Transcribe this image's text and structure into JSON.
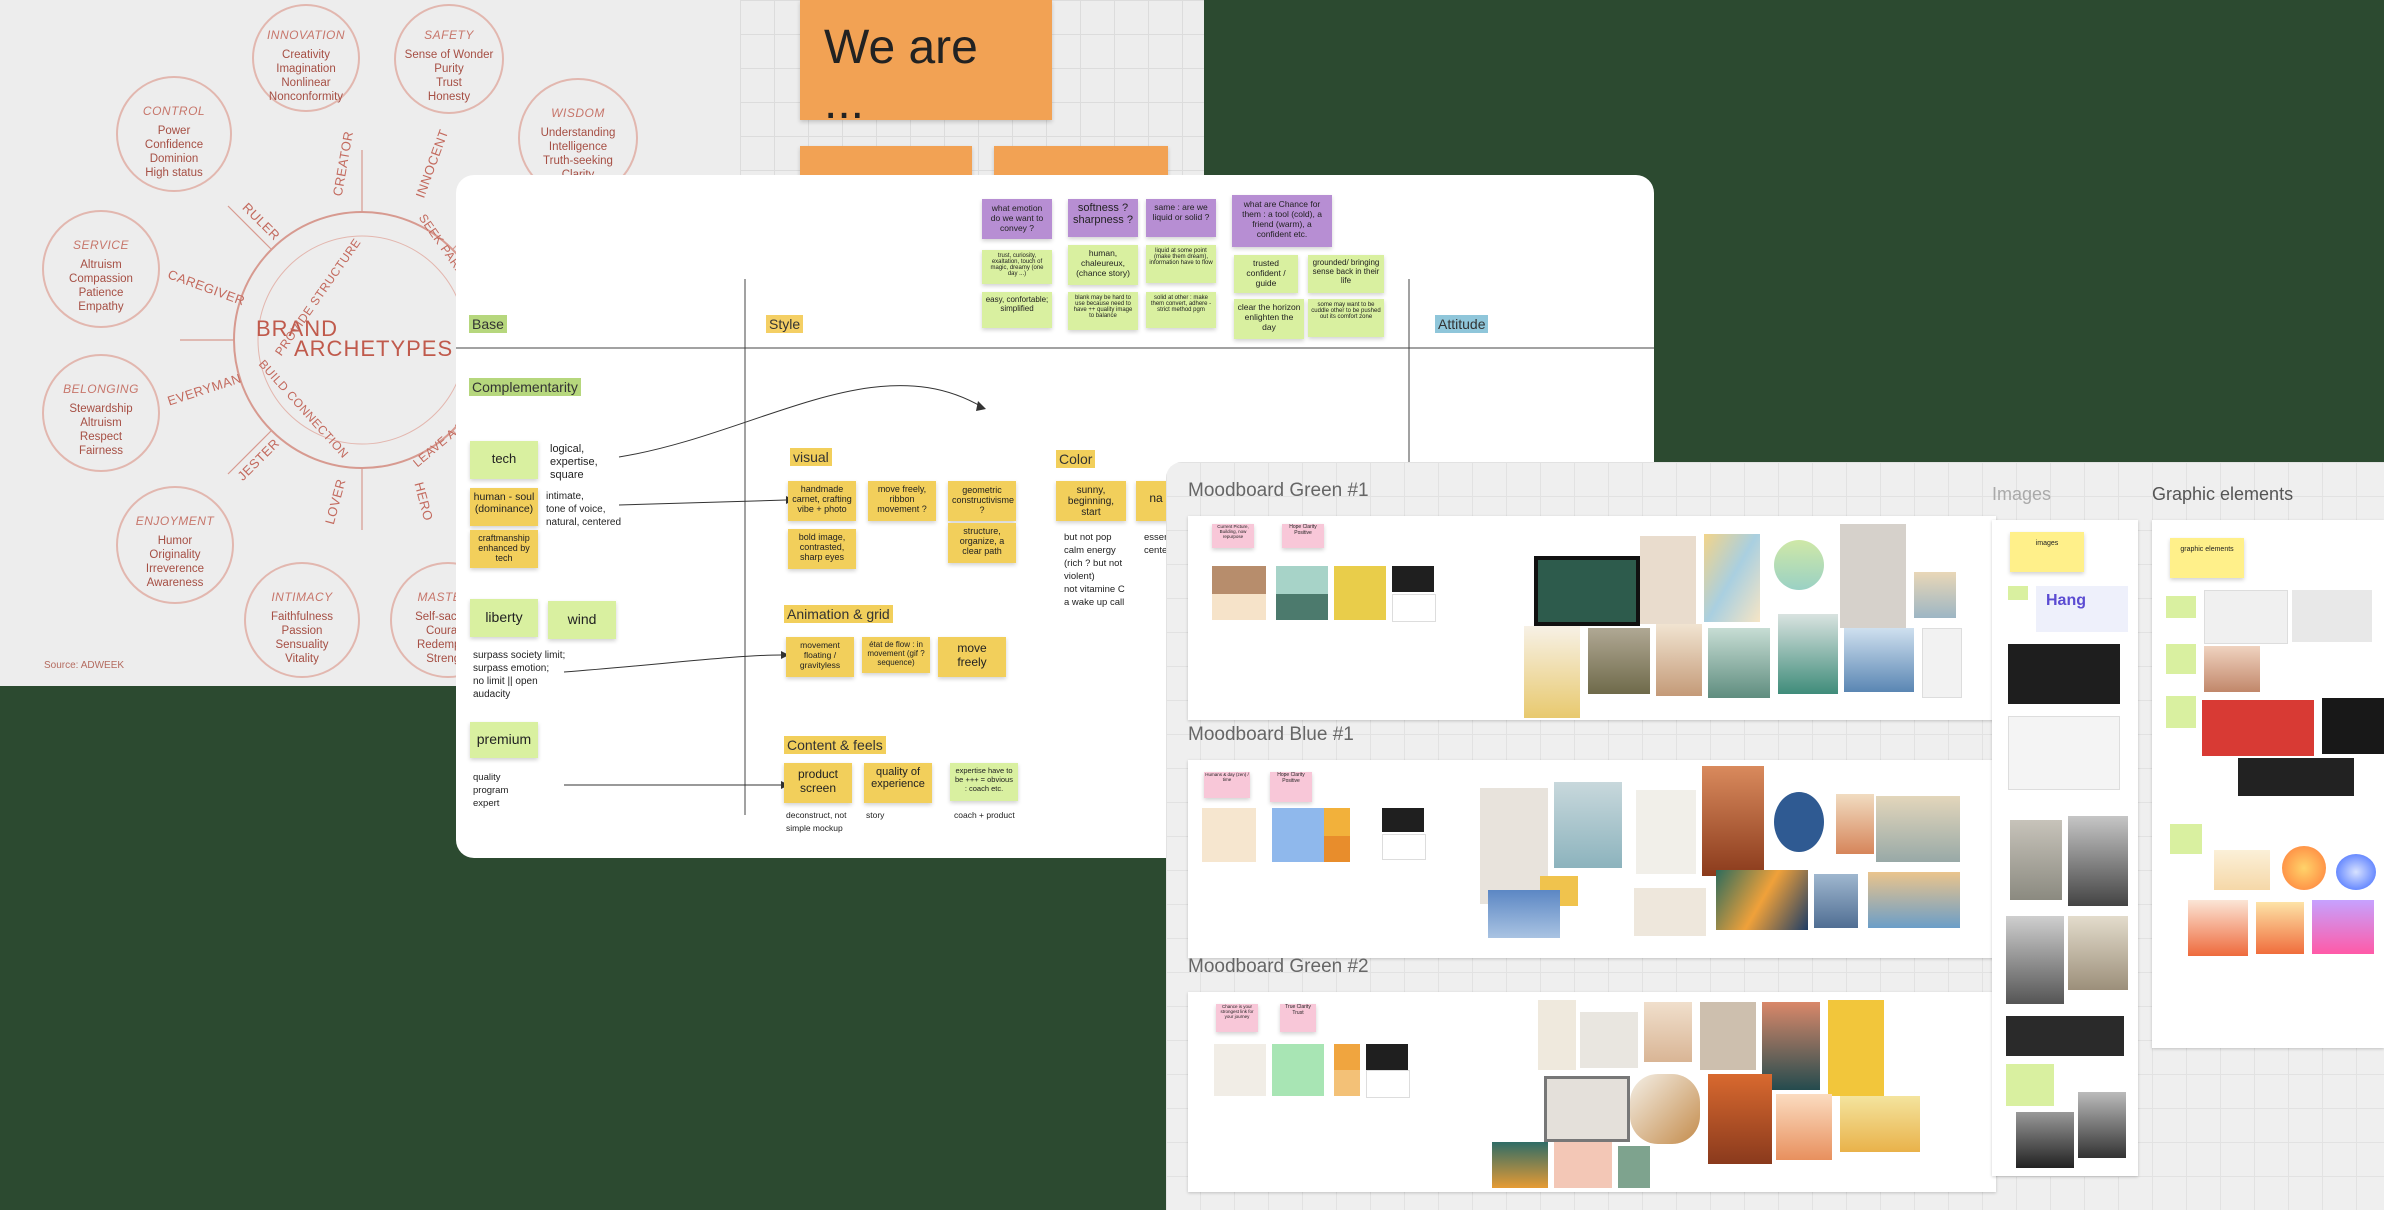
{
  "archetypes": {
    "title": "BRAND ARCHETYPES",
    "source": "Source: ADWEEK",
    "ring_labels": [
      "PROVIDE STRUCTURE",
      "SEEK PARADISE",
      "LEAVE A MARK",
      "BUILD CONNECTION"
    ],
    "circles": [
      {
        "title": "INNOVATION",
        "lines": [
          "Creativity",
          "Imagination",
          "Nonlinear",
          "Nonconformity"
        ]
      },
      {
        "title": "SAFETY",
        "lines": [
          "Sense of Wonder",
          "Purity",
          "Trust",
          "Honesty"
        ]
      },
      {
        "title": "CONTROL",
        "lines": [
          "Power",
          "Confidence",
          "Dominion",
          "High status"
        ]
      },
      {
        "title": "WISDOM",
        "lines": [
          "Understanding",
          "Intelligence",
          "Truth-seeking",
          "Clarity"
        ]
      },
      {
        "title": "SERVICE",
        "lines": [
          "Altruism",
          "Compassion",
          "Patience",
          "Empathy"
        ]
      },
      {
        "title": "BELONGING",
        "lines": [
          "Stewardship",
          "Altruism",
          "Respect",
          "Fairness"
        ]
      },
      {
        "title": "ENJOYMENT",
        "lines": [
          "Humor",
          "Originality",
          "Irreverence",
          "Awareness"
        ]
      },
      {
        "title": "INTIMACY",
        "lines": [
          "Faithfulness",
          "Passion",
          "Sensuality",
          "Vitality"
        ]
      },
      {
        "title": "MASTERY",
        "lines": [
          "Self-sacrifice",
          "Courage",
          "Redemption",
          "Strength"
        ]
      }
    ],
    "names": [
      "CREATOR",
      "INNOCENT",
      "RULER",
      "CAREGIVER",
      "EVERYMAN",
      "JESTER",
      "LOVER",
      "HERO"
    ]
  },
  "we_are": {
    "text": "We are ..."
  },
  "map": {
    "columns": {
      "base": "Base",
      "style": "Style",
      "attitude": "Attitude"
    },
    "questions": [
      {
        "text": "what emotion do we want to convey ?",
        "answers": [
          "trust, curiosity, exaltation, touch of magic, dreamy (one day ...)",
          "easy, confortable; simplified"
        ]
      },
      {
        "text": "softness ? sharpness ?",
        "answers": [
          "human, chaleureux, (chance story)",
          "blank may be hard to use because need to have ++ quality image to balance"
        ]
      },
      {
        "text": "same : are we liquid or solid ?",
        "answers": [
          "liquid at some point (make them dream), information have to flow",
          "solid at other : make them convert, adhere - strict method pgm"
        ]
      },
      {
        "text": "what are Chance for them : a tool (cold), a friend (warm), a confident etc.",
        "answers": [
          "trusted confident / guide",
          "grounded/ bringing sense back in their life",
          "clear the horizon enlighten the day",
          "some may want to be cuddle other to be pushed out its comfort zone"
        ]
      }
    ],
    "complementarity": "Complementarity",
    "base_items": [
      {
        "label": "tech",
        "note": "logical,\nexpertise,\nsquare"
      },
      {
        "label": "human - soul (dominance)",
        "note": "intimate,\ntone of voice,\nnatural, centered"
      },
      {
        "label": "craftmanship enhanced by tech",
        "note": ""
      },
      {
        "label": "liberty",
        "note": ""
      },
      {
        "label": "wind",
        "note": ""
      },
      {
        "label": "premium",
        "note": "quality\nprogram\nexpert"
      }
    ],
    "liberty_note": "surpass society limit;\nsurpass emotion;\nno limit || open\naudacity",
    "visual": {
      "title": "visual",
      "items": [
        "handmade carnet, crafting vibe + photo",
        "move freely, ribbon movement ?",
        "geometric constructivisme ?",
        "bold image, contrasted, sharp eyes",
        "structure, organize, a clear path"
      ]
    },
    "color": {
      "title": "Color",
      "items": [
        "sunny, beginning, start",
        "na"
      ],
      "note": "but not pop\ncalm energy\n(rich ? but not\nviolent)\nnot vitamine C\na wake up call",
      "note2": "essen\ncenter"
    },
    "animation": {
      "title": "Animation & grid",
      "items": [
        "movement floating / gravityless",
        "état de flow : in movement (gif ? sequence)",
        "move freely"
      ]
    },
    "content": {
      "title": "Content & feels",
      "items": [
        "product screen",
        "quality of experience",
        "expertise have to be +++ = obvious : coach etc."
      ],
      "notes": [
        "deconstruct, not\nsimple mockup",
        "story",
        "coach + product"
      ]
    }
  },
  "moodboards": [
    {
      "title": "Moodboard Green #1",
      "notes": [
        "Current Picture, Building, now repurpose",
        "Hope Clarity Positive"
      ],
      "swatches": [
        "#b78d6c",
        "#f6e3c9",
        "#a7d3c8",
        "#4c7a6d",
        "#e9cd4a",
        "#1f1f1f",
        "#ffffff"
      ]
    },
    {
      "title": "Moodboard Blue #1",
      "notes": [
        "Humans & day (zen) / time",
        "Hope Clarity Positive"
      ],
      "swatches": [
        "#f6e6cf",
        "#8fb8ec",
        "#f2b13b",
        "#e88d2c",
        "#1f1f1f",
        "#ffffff"
      ]
    },
    {
      "title": "Moodboard Green #2",
      "notes": [
        "Chance is your strongest link for your journey",
        "True Clarity Trust"
      ],
      "swatches": [
        "#f1ede6",
        "#a8e5b4",
        "#f0a53f",
        "#f3c177",
        "#1f1f1f",
        "#ffffff"
      ]
    }
  ],
  "images_col": {
    "title": "Images",
    "sticky": "images",
    "labels": [
      "Hang"
    ]
  },
  "graphic_col": {
    "title": "Graphic elements",
    "sticky": "graphic elements"
  },
  "colors": {
    "background": "#2c4a30",
    "sticky_orange": "#f2a254",
    "sticky_green": "#d9f0a0",
    "sticky_yellow": "#f2cf5b",
    "sticky_purple": "#b78ed3",
    "sticky_pink": "#f8c7d8"
  }
}
